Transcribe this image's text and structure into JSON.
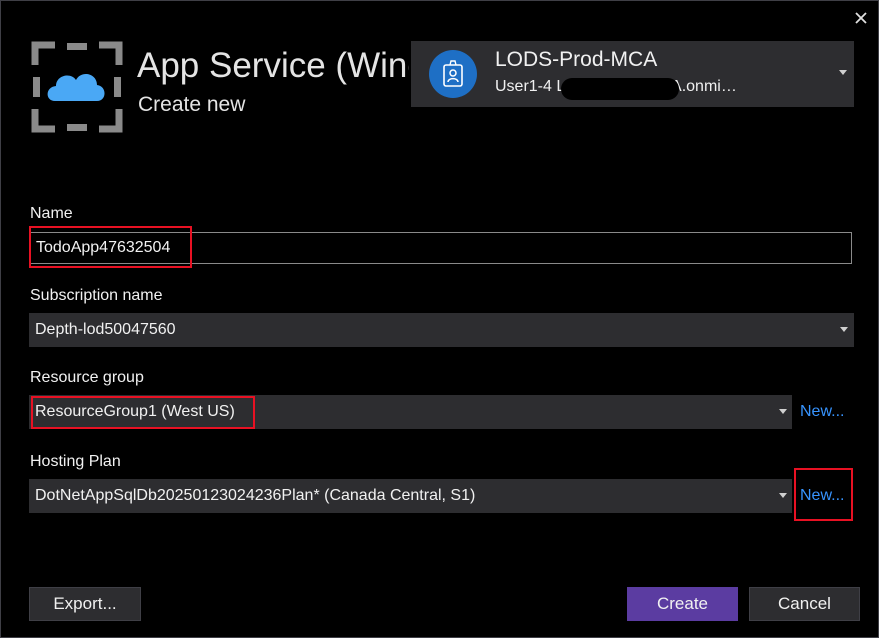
{
  "dialog": {
    "title": "App Service (Windows)",
    "subtitle": "Create new",
    "close_icon": "close-icon"
  },
  "account": {
    "name": "LODS-Prod-MCA",
    "email": "User1-4          LODSPRODMCA.onmi…",
    "avatar_icon": "id-badge-icon"
  },
  "form": {
    "name_label": "Name",
    "name_value": "TodoApp47632504",
    "subscription_label": "Subscription name",
    "subscription_value": "Depth-lod50047560",
    "resource_group_label": "Resource group",
    "resource_group_value": "ResourceGroup1 (West US)",
    "resource_group_new": "New...",
    "hosting_plan_label": "Hosting Plan",
    "hosting_plan_value": "DotNetAppSqlDb20250123024236Plan* (Canada Central, S1)",
    "hosting_plan_new": "New..."
  },
  "buttons": {
    "export": "Export...",
    "create": "Create",
    "cancel": "Cancel"
  },
  "colors": {
    "background": "#000000",
    "input_bg": "#2d2d30",
    "primary_button": "#5b3ca1",
    "link": "#3794ff",
    "highlight": "#e81123",
    "cloud": "#4aa8f5"
  }
}
